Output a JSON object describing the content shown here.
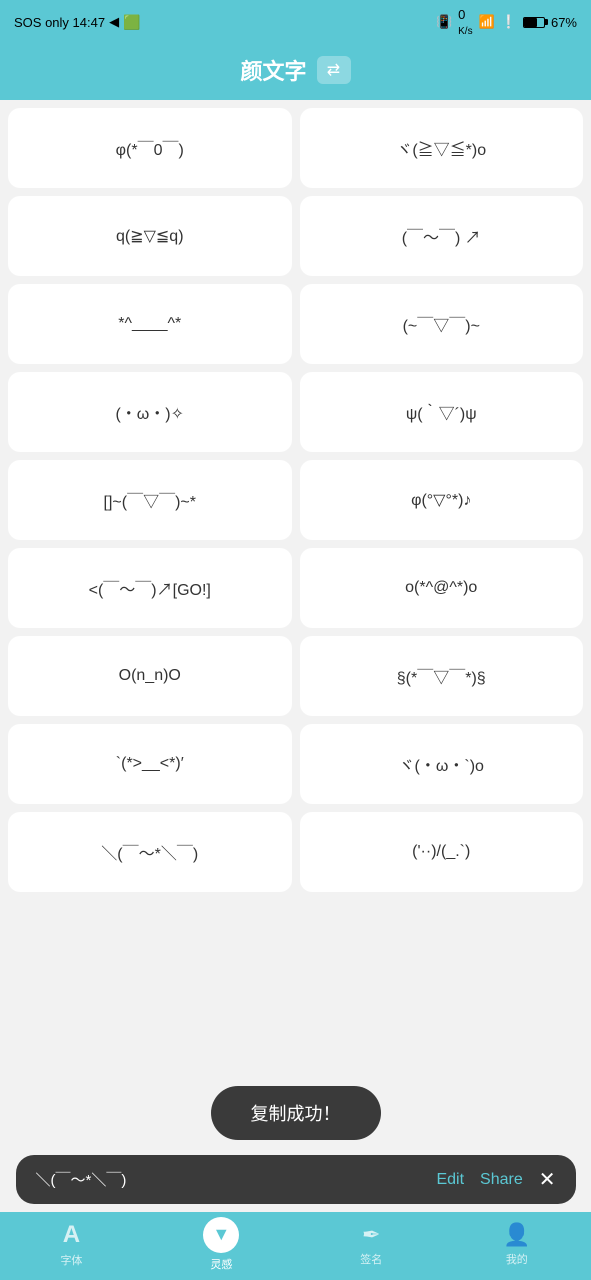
{
  "statusBar": {
    "left": "SOS only  14:47",
    "right": "0 K/s  67%"
  },
  "header": {
    "title": "颜文字",
    "iconLabel": "⇄"
  },
  "kaomojis": [
    "φ(*￣0￣)",
    "ヾ(≧▽≦*)o",
    "q(≧▽≦q)",
    "(￣～￣) ↗",
    "*^____^*",
    "(~￣▽￣)~",
    "(・ω・)✧",
    "ψ(｀▽´)ψ",
    "[]~(￣▽￣)~*",
    "φ(°▽°*)♪",
    "<(￣～￣)↗[GO!]",
    "o(*^@^*)o",
    "O(n_n)O",
    "§(*￣▽￣*)§",
    "`(*>__<*)′",
    "ヾ(・ω・`)o",
    "＼(￣～*＼￣)",
    "('··)/(_.`)"
  ],
  "popup": {
    "kaomoji": "＼(￣～*＼￣)",
    "editLabel": "Edit",
    "shareLabel": "Share"
  },
  "toast": {
    "text": "复制成功！"
  },
  "bottomNav": {
    "items": [
      {
        "id": "font",
        "icon": "A",
        "label": "字体",
        "active": false
      },
      {
        "id": "inspire",
        "icon": "▼",
        "label": "灵感",
        "active": true
      },
      {
        "id": "sign",
        "icon": "✒",
        "label": "签名",
        "active": false
      },
      {
        "id": "mine",
        "icon": "👤",
        "label": "我的",
        "active": false
      }
    ]
  }
}
